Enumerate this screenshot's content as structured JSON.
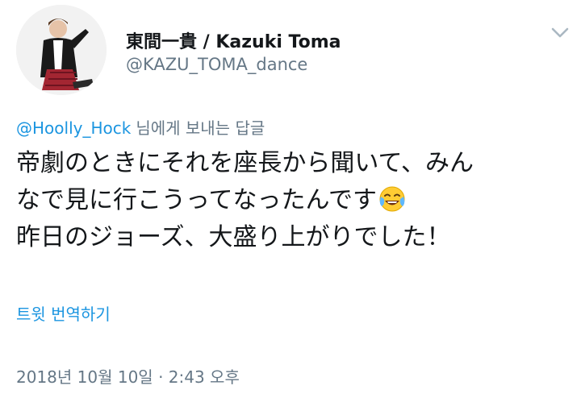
{
  "author": {
    "display_name": "東間一貴 / Kazuki Toma",
    "handle": "@KAZU_TOMA_dance"
  },
  "reply_context": {
    "mention": "@Hoolly_Hock",
    "suffix": "님에게 보내는 답글"
  },
  "tweet": {
    "line1": "帝劇のときにそれを座長から聞いて、みん",
    "line2": "なで見に行こうってなったんです",
    "line2_emoji": "face-with-tears-of-joy",
    "line3": "昨日のジョーズ、大盛り上がりでした！"
  },
  "actions": {
    "translate_label": "트윗 번역하기"
  },
  "meta": {
    "timestamp": "2018년 10월 10일 · 2:43 오후"
  },
  "colors": {
    "link": "#1b95e0",
    "secondary_text": "#657786",
    "primary_text": "#14171a"
  },
  "icons": {
    "menu": "chevron-down-icon",
    "avatar": "profile-photo"
  }
}
